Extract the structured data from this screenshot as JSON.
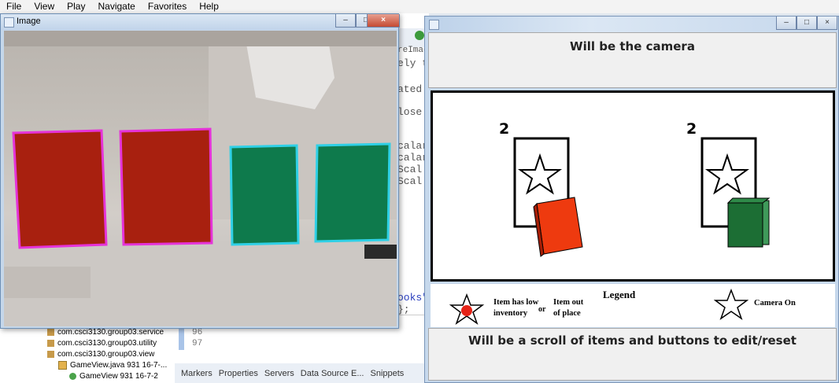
{
  "menu": [
    "File",
    "View",
    "Play",
    "Navigate",
    "Favorites",
    "Help"
  ],
  "image_window": {
    "title": "Image"
  },
  "ide": {
    "code_fragments": [
      "• ",
      "reImag",
      "ely t",
      "ated",
      "lose",
      "calar",
      "calar",
      " Scal",
      " Scal",
      "ooks\"",
      "};"
    ],
    "line_numbers": [
      "96",
      "97"
    ],
    "bottom_tabs": [
      "Markers",
      "Properties",
      "Servers",
      "Data Source E...",
      "Snippets"
    ],
    "tree": [
      "com.csci3130.group03.service",
      "com.csci3130.group03.utility",
      "com.csci3130.group03.view",
      "GameView.java 931  16-7-...",
      "GameView 931  16-7-2"
    ]
  },
  "game_window": {
    "header": "Will be the camera",
    "footer": "Will be a scroll of items and buttons to edit/reset",
    "slots": [
      {
        "count": "2",
        "book_color": "#ee3a0f"
      },
      {
        "count": "2",
        "book_color": "#1c6e34"
      }
    ],
    "legend": {
      "title": "Legend",
      "low_inventory": [
        "Item has low",
        "inventory"
      ],
      "or": "or",
      "out_of_place": [
        "Item out",
        "of place"
      ],
      "camera_on": "Camera On"
    }
  },
  "colors": {
    "red_book": "#a8200f",
    "green_book": "#0e7a4c",
    "red_outline": "#e533d8",
    "green_outline": "#2fd0e6"
  }
}
